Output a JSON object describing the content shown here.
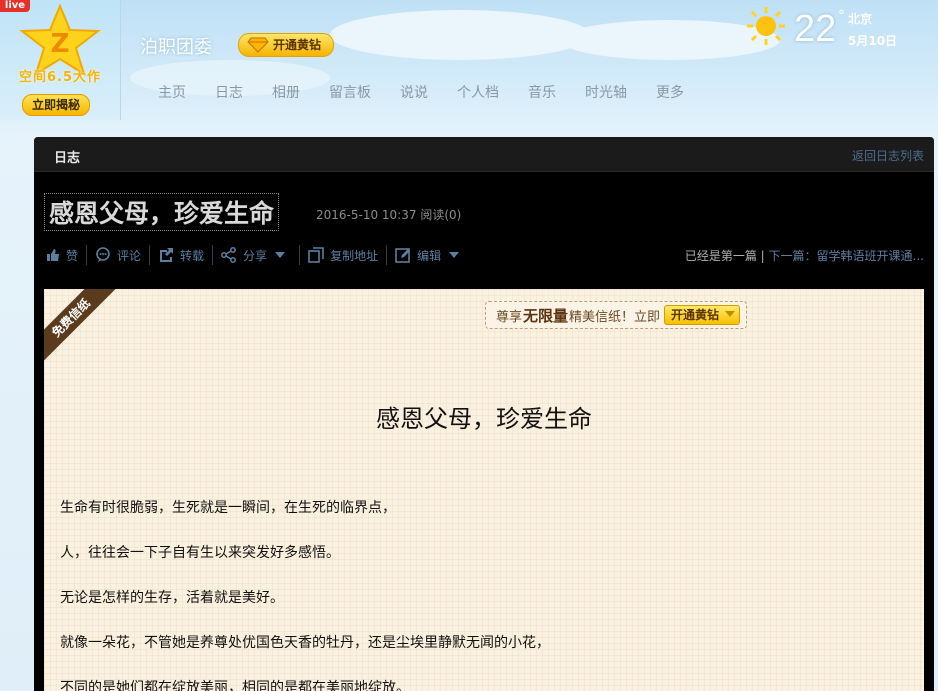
{
  "logo": {
    "live_badge": "live",
    "caption": "空间6.5大作",
    "reveal_button": "立即揭秘"
  },
  "header": {
    "site_name": "泊职团委",
    "vip_button": "开通黄钻",
    "weather": {
      "temperature": "22",
      "degree_mark": "°",
      "city": "北京",
      "date": "5月10日"
    }
  },
  "nav": {
    "items": [
      "主页",
      "日志",
      "相册",
      "留言板",
      "说说",
      "个人档",
      "音乐",
      "时光轴",
      "更多"
    ]
  },
  "panel": {
    "section_title": "日志",
    "back_link": "返回日志列表",
    "post_title": "感恩父母，珍爱生命",
    "post_datetime": "2016-5-10 10:37",
    "read_count": "阅读(0)",
    "actions": {
      "like": "赞",
      "comment": "评论",
      "repost": "转载",
      "share": "分享",
      "copy_link": "复制地址",
      "edit": "编辑"
    },
    "prev_text": "已经是第一篇",
    "divider": "|",
    "next_text": "下一篇：留学韩语班开课通..."
  },
  "paper": {
    "ribbon": "免费信纸",
    "promo_prefix": "尊享",
    "promo_strong": "无限量",
    "promo_suffix": "精美信纸！立即",
    "promo_button": "开通黄钻",
    "title": "感恩父母，珍爱生命",
    "paragraphs": [
      "生命有时很脆弱，生死就是一瞬间，在生死的临界点，",
      "人，往往会一下子自有生以来突发好多感悟。",
      "无论是怎样的生存，活着就是美好。",
      "就像一朵花，不管她是养尊处优国色天香的牡丹，还是尘埃里静默无闻的小花，",
      "不同的是她们都在绽放美丽，相同的是都在美丽地绽放。"
    ]
  },
  "colors": {
    "panel_bg": "#000000",
    "link_blue": "#5d7f9f",
    "paper_bg": "#fbf1e0",
    "gold": "#f6c100",
    "ribbon_brown": "#5b3b1e"
  }
}
